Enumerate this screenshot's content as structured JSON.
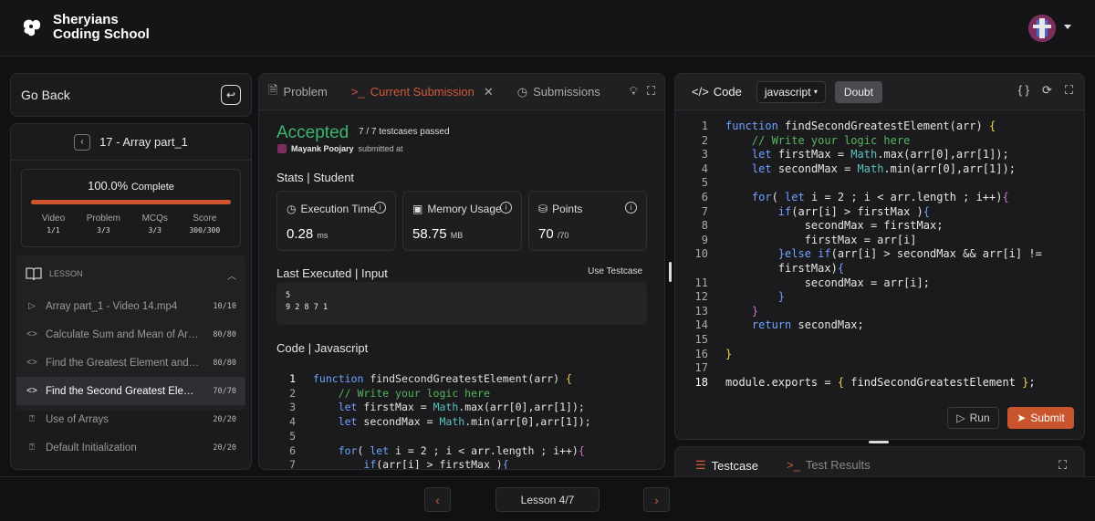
{
  "brand": {
    "name_line1": "Sheryians",
    "name_line2": "Coding School"
  },
  "sidebar": {
    "go_back": "Go Back",
    "chapter": "17 - Array part_1",
    "progress": {
      "percent_label": "100.0%",
      "complete_label": "Complete",
      "fraction": 1.0,
      "stats": [
        {
          "k": "Video",
          "v": "1/1"
        },
        {
          "k": "Problem",
          "v": "3/3"
        },
        {
          "k": "MCQs",
          "v": "3/3"
        },
        {
          "k": "Score",
          "v": "300/300"
        }
      ]
    },
    "lesson_header": "LESSON",
    "items": [
      {
        "label": "Array part_1 - Video 14.mp4",
        "score": "10/10",
        "icon": "play-icon"
      },
      {
        "label": "Calculate Sum and Mean of Array...",
        "score": "80/80",
        "icon": "code-icon"
      },
      {
        "label": "Find the Greatest Element and Its...",
        "score": "80/80",
        "icon": "code-icon"
      },
      {
        "label": "Find the Second Greatest Element",
        "score": "70/70",
        "icon": "code-icon",
        "active": true
      },
      {
        "label": "Use of Arrays",
        "score": "20/20",
        "icon": "quiz-icon"
      },
      {
        "label": "Default Initialization",
        "score": "20/20",
        "icon": "quiz-icon"
      }
    ]
  },
  "middle": {
    "tabs": [
      "Problem",
      "Current Submission",
      "Submissions"
    ],
    "status": "Accepted",
    "testcases": "7 / 7 testcases passed",
    "author": "Mayank Poojary",
    "submitted_at": "submitted at",
    "stats_title": "Stats | Student",
    "cards": [
      {
        "title": "Execution Time",
        "value": "0.28",
        "unit": "ms"
      },
      {
        "title": "Memory Usage",
        "value": "58.75",
        "unit": "MB"
      },
      {
        "title": "Points",
        "value": "70",
        "unit": "/70"
      }
    ],
    "last_executed": "Last Executed | Input",
    "use_testcase": "Use Testcase",
    "input": "5\n9 2 8 7 1",
    "code_title": "Code | Javascript"
  },
  "editor": {
    "code_label": "Code",
    "language": "javascript",
    "doubt": "Doubt",
    "run": "Run",
    "submit": "Submit"
  },
  "bottom": {
    "testcase": "Testcase",
    "test_results": "Test Results"
  },
  "footer": {
    "lesson": "Lesson 4/7"
  },
  "colors": {
    "accent": "#d25a36",
    "accepted": "#3cb66b",
    "progress": "#d0552f"
  }
}
